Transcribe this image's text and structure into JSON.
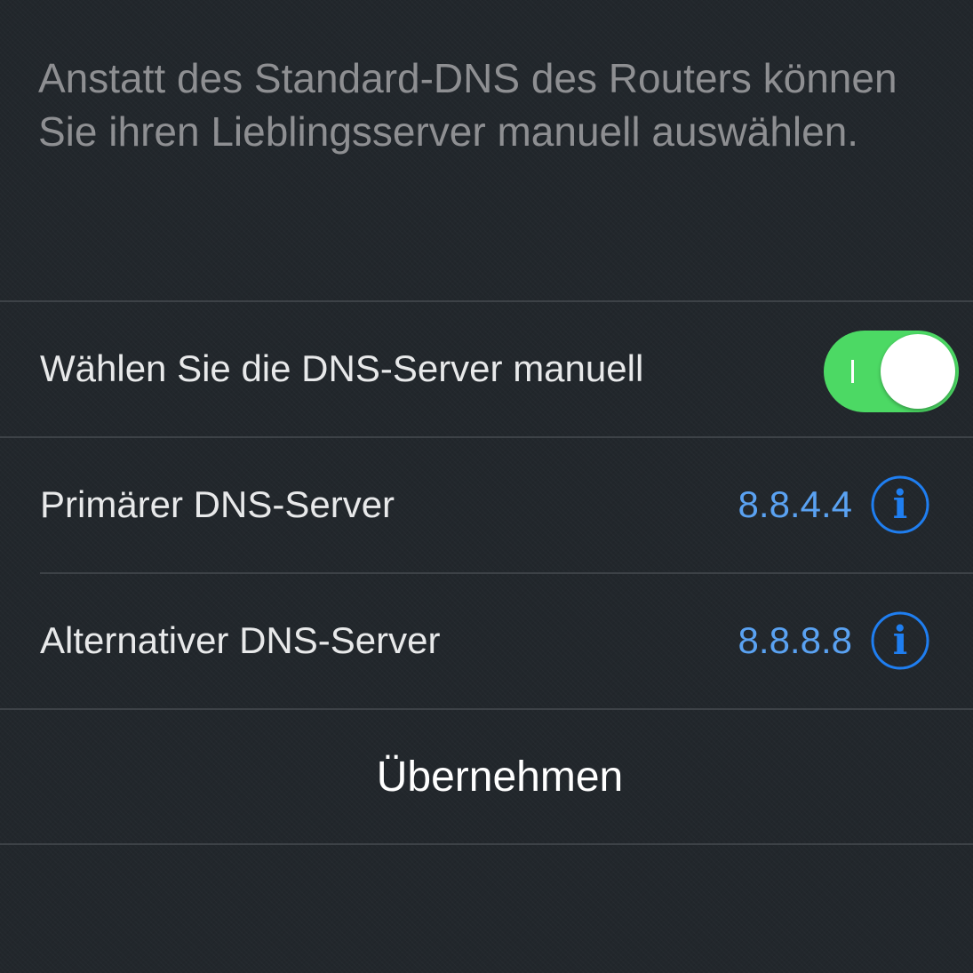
{
  "description": "Anstatt des Standard-DNS des Routers können Sie ihren Lieblingsserver manuell auswählen.",
  "manual_dns": {
    "label": "Wählen Sie die DNS-Server manuell",
    "enabled": true,
    "toggle_color": "#4cd964"
  },
  "primary_dns": {
    "label": "Primärer DNS-Server",
    "value": "8.8.4.4",
    "icon": "info-icon"
  },
  "alternative_dns": {
    "label": "Alternativer DNS-Server",
    "value": "8.8.8.8",
    "icon": "info-icon"
  },
  "apply_button": {
    "label": "Übernehmen"
  },
  "colors": {
    "accent": "#5aa2f2",
    "background": "#22272c"
  }
}
